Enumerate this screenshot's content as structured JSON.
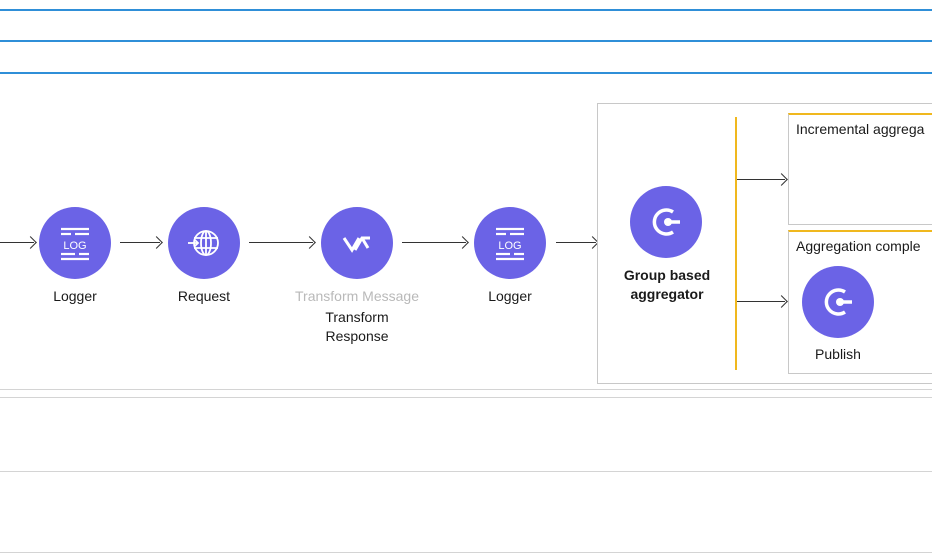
{
  "flow": {
    "nodes": [
      {
        "label": "Logger",
        "icon": "log-icon"
      },
      {
        "label": "Request",
        "icon": "globe-icon"
      },
      {
        "label_dimmed": "Transform Message",
        "label_line1": "Transform",
        "label_line2": "Response",
        "icon": "transform-icon"
      },
      {
        "label": "Logger",
        "icon": "log-icon"
      }
    ],
    "aggregator": {
      "label_line1": "Group based",
      "label_line2": "aggregator",
      "icon": "aggregator-icon",
      "routes": [
        {
          "title": "Incremental aggrega"
        },
        {
          "title": "Aggregation comple",
          "node_label": "Publish",
          "node_icon": "aggregator-icon"
        }
      ]
    }
  },
  "colors": {
    "node": "#6b63e6",
    "accent_line": "#2f8fd8",
    "route_bar": "#f0b81e"
  }
}
